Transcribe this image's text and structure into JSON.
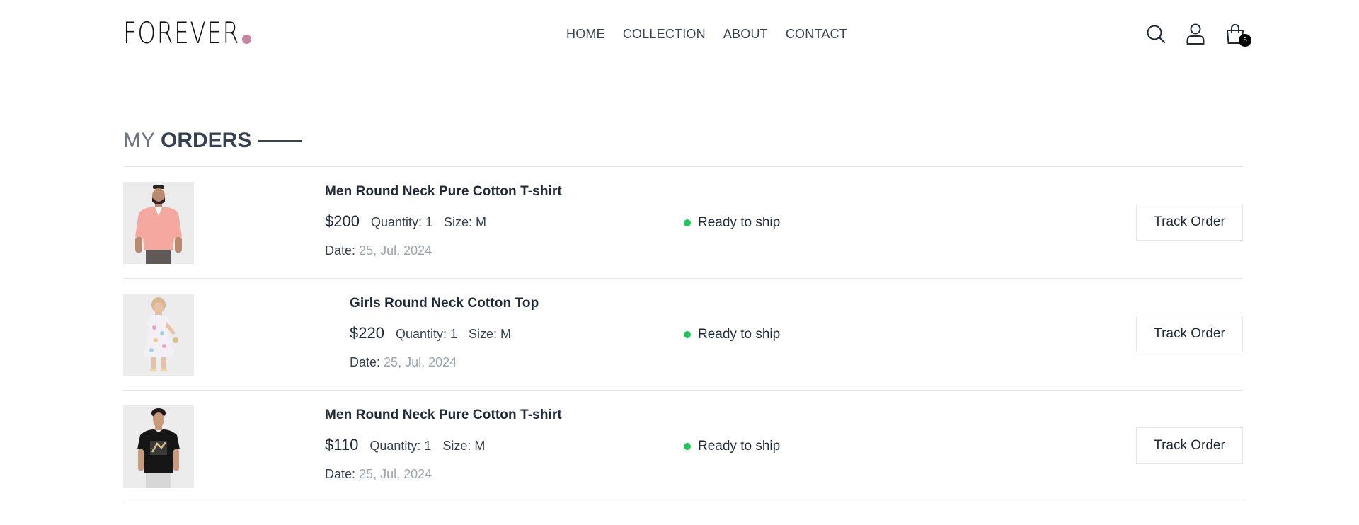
{
  "header": {
    "logo": "FOREVER",
    "nav": [
      "HOME",
      "COLLECTION",
      "ABOUT",
      "CONTACT"
    ],
    "cart_count": "5",
    "icons": [
      "search-icon",
      "profile-icon",
      "cart-icon"
    ]
  },
  "page": {
    "title_light": "MY",
    "title_bold": "ORDERS"
  },
  "orders": [
    {
      "name": "Men Round Neck Pure Cotton T-shirt",
      "price": "$200",
      "quantity": "Quantity: 1",
      "size": "Size: M",
      "date_label": "Date:",
      "date": "25, Jul, 2024",
      "status": "Ready to ship",
      "button": "Track Order",
      "image": "man-pink-polo-shirt"
    },
    {
      "name": "Girls Round Neck Cotton Top",
      "price": "$220",
      "quantity": "Quantity: 1",
      "size": "Size: M",
      "date_label": "Date:",
      "date": "25, Jul, 2024",
      "status": "Ready to ship",
      "button": "Track Order",
      "image": "girl-floral-dress"
    },
    {
      "name": "Men Round Neck Pure Cotton T-shirt",
      "price": "$110",
      "quantity": "Quantity: 1",
      "size": "Size: M",
      "date_label": "Date:",
      "date": "25, Jul, 2024",
      "status": "Ready to ship",
      "button": "Track Order",
      "image": "man-black-tshirt"
    }
  ],
  "colors": {
    "status_green": "#22c55e",
    "logo_dot": "#c586a5",
    "text_dark": "#1f2937",
    "text_muted": "#9ca3af"
  }
}
